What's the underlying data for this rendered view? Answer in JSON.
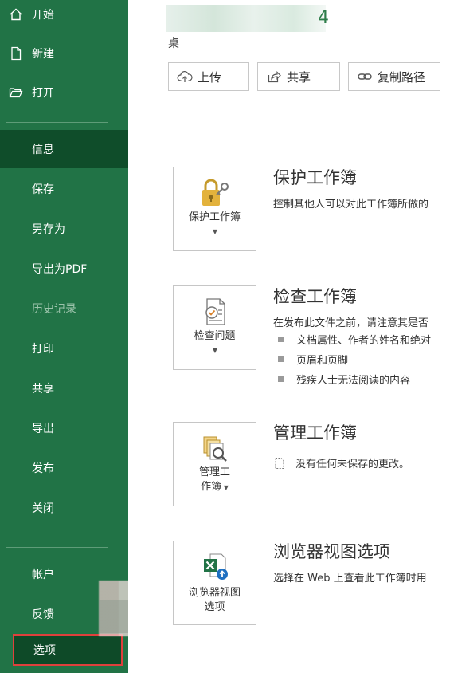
{
  "sidebar": {
    "top_items": [
      {
        "label": "开始",
        "icon": "home-icon"
      },
      {
        "label": "新建",
        "icon": "new-document-icon"
      },
      {
        "label": "打开",
        "icon": "open-folder-icon"
      }
    ],
    "items": [
      {
        "label": "信息",
        "state": "active"
      },
      {
        "label": "保存"
      },
      {
        "label": "另存为"
      },
      {
        "label": "导出为PDF"
      },
      {
        "label": "历史记录",
        "state": "disabled"
      },
      {
        "label": "打印"
      },
      {
        "label": "共享"
      },
      {
        "label": "导出"
      },
      {
        "label": "发布"
      },
      {
        "label": "关闭"
      }
    ],
    "bottom_items": [
      {
        "label": "帐户"
      },
      {
        "label": "反馈"
      },
      {
        "label": "选项",
        "state": "highlighted"
      }
    ]
  },
  "header": {
    "title_visible_tail": "4",
    "path_label": "桌"
  },
  "toolbar": {
    "upload_label": "上传",
    "share_label": "共享",
    "copy_path_label": "复制路径"
  },
  "sections": {
    "protect": {
      "tile_label": "保护工作簿",
      "title": "保护工作簿",
      "description": "控制其他人可以对此工作簿所做的"
    },
    "inspect": {
      "tile_label": "检查问题",
      "title": "检查工作簿",
      "description": "在发布此文件之前，请注意其是否",
      "bullets": [
        "文档属性、作者的姓名和绝对",
        "页眉和页脚",
        "残疾人士无法阅读的内容"
      ]
    },
    "manage": {
      "tile_label_line1": "管理工",
      "tile_label_line2": "作簿",
      "title": "管理工作簿",
      "note": "没有任何未保存的更改。"
    },
    "browser": {
      "tile_label_line1": "浏览器视图",
      "tile_label_line2": "选项",
      "title": "浏览器视图选项",
      "description": "选择在 Web 上查看此工作簿时用"
    }
  },
  "colors": {
    "sidebar_bg": "#217346",
    "sidebar_active": "#0f4d2a",
    "highlight_border": "#e0403c"
  }
}
